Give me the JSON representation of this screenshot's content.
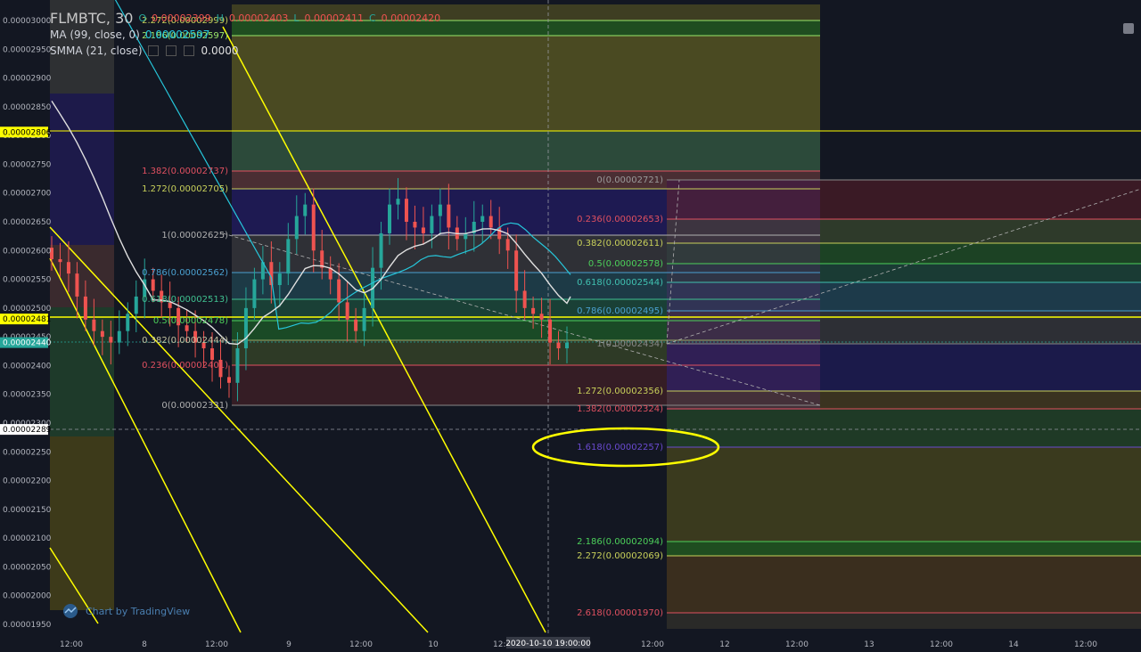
{
  "legend": {
    "symbol": "FLMBTC, 30",
    "ohlc": {
      "o_label": "O",
      "o": "0.00002399",
      "h_label": "H",
      "h": "0.00002403",
      "l_label": "L",
      "l": "0.00002411",
      "c_label": "C",
      "c": "0.00002420"
    },
    "ma_label": "MA (99, close, 0)",
    "ma_value": "0.00002597",
    "smma_label": "SMMA (21, close)",
    "smma_value": "0.0000"
  },
  "watermark": "Chart by TradingView",
  "colors": {
    "bg": "#131722",
    "up": "#26a69a",
    "down": "#ef5350",
    "yellow": "#ffff00",
    "ma": "#26c6da",
    "smma": "#e0e0e0"
  },
  "price_axis": {
    "ticks": [
      "0.00003000",
      "0.00002950",
      "0.00002900",
      "0.00002850",
      "0.00002800",
      "0.00002750",
      "0.00002700",
      "0.00002650",
      "0.00002600",
      "0.00002550",
      "0.00002500",
      "0.00002450",
      "0.00002400",
      "0.00002350",
      "0.00002300",
      "0.00002250",
      "0.00002200",
      "0.00002150",
      "0.00002100",
      "0.00002050",
      "0.00002000",
      "0.00001950"
    ],
    "badges": [
      {
        "label": "0.00002806",
        "color": "#ffff00"
      },
      {
        "label": "0.00002481",
        "color": "#ffff00"
      },
      {
        "label": "0.00002440",
        "color": "#26a69a"
      },
      {
        "label": "0.00002289",
        "color": "#ffffff"
      }
    ]
  },
  "time_axis": {
    "labels": [
      "12:00",
      "8",
      "12:00",
      "9",
      "12:00",
      "10",
      "12:00",
      "12:00",
      "12",
      "12:00",
      "13",
      "12:00",
      "14",
      "12:00"
    ],
    "crosshair_label": "2020-10-10 19:00:00"
  },
  "fib_left": {
    "levels": [
      "2.272(0.00002999)",
      "2.186(0.00002597)",
      "1.382(0.00002737)",
      "1.272(0.00002705)",
      "1(0.00002625)",
      "0.786(0.00002562)",
      "0.618(0.00002513)",
      "0.5(0.00002478)",
      "0.382(0.00002444)",
      "0.236(0.00002401)",
      "0(0.00002331)"
    ]
  },
  "fib_right": {
    "levels": [
      "0(0.00002721)",
      "0.236(0.00002653)",
      "0.382(0.00002611)",
      "0.5(0.00002578)",
      "0.618(0.00002544)",
      "0.786(0.00002495)",
      "1(0.00002434)",
      "1.272(0.00002356)",
      "1.382(0.00002324)",
      "1.618(0.00002257)",
      "2.186(0.00002094)",
      "2.272(0.00002069)",
      "2.618(0.00001970)"
    ]
  },
  "chart_data": {
    "type": "candlestick",
    "symbol": "FLMBTC",
    "interval": "30",
    "ylim": [
      1.94e-05,
      3.04e-05
    ],
    "indicators": [
      "MA (99, close, 0)",
      "SMMA (21, close)"
    ],
    "close_series": [
      2.585e-05,
      2.58e-05,
      2.56e-05,
      2.52e-05,
      2.48e-05,
      2.46e-05,
      2.45e-05,
      2.44e-05,
      2.46e-05,
      2.49e-05,
      2.52e-05,
      2.55e-05,
      2.53e-05,
      2.51e-05,
      2.5e-05,
      2.47e-05,
      2.46e-05,
      2.44e-05,
      2.43e-05,
      2.41e-05,
      2.38e-05,
      2.37e-05,
      2.43e-05,
      2.5e-05,
      2.55e-05,
      2.58e-05,
      2.54e-05,
      2.56e-05,
      2.62e-05,
      2.66e-05,
      2.68e-05,
      2.6e-05,
      2.57e-05,
      2.55e-05,
      2.51e-05,
      2.48e-05,
      2.46e-05,
      2.5e-05,
      2.57e-05,
      2.63e-05,
      2.68e-05,
      2.69e-05,
      2.65e-05,
      2.64e-05,
      2.63e-05,
      2.66e-05,
      2.68e-05,
      2.64e-05,
      2.62e-05,
      2.63e-05,
      2.65e-05,
      2.66e-05,
      2.64e-05,
      2.62e-05,
      2.6e-05,
      2.53e-05,
      2.5e-05,
      2.49e-05,
      2.48e-05,
      2.44e-05,
      2.43e-05,
      2.44e-05
    ],
    "annotation": "1.618(0.00002257)"
  }
}
